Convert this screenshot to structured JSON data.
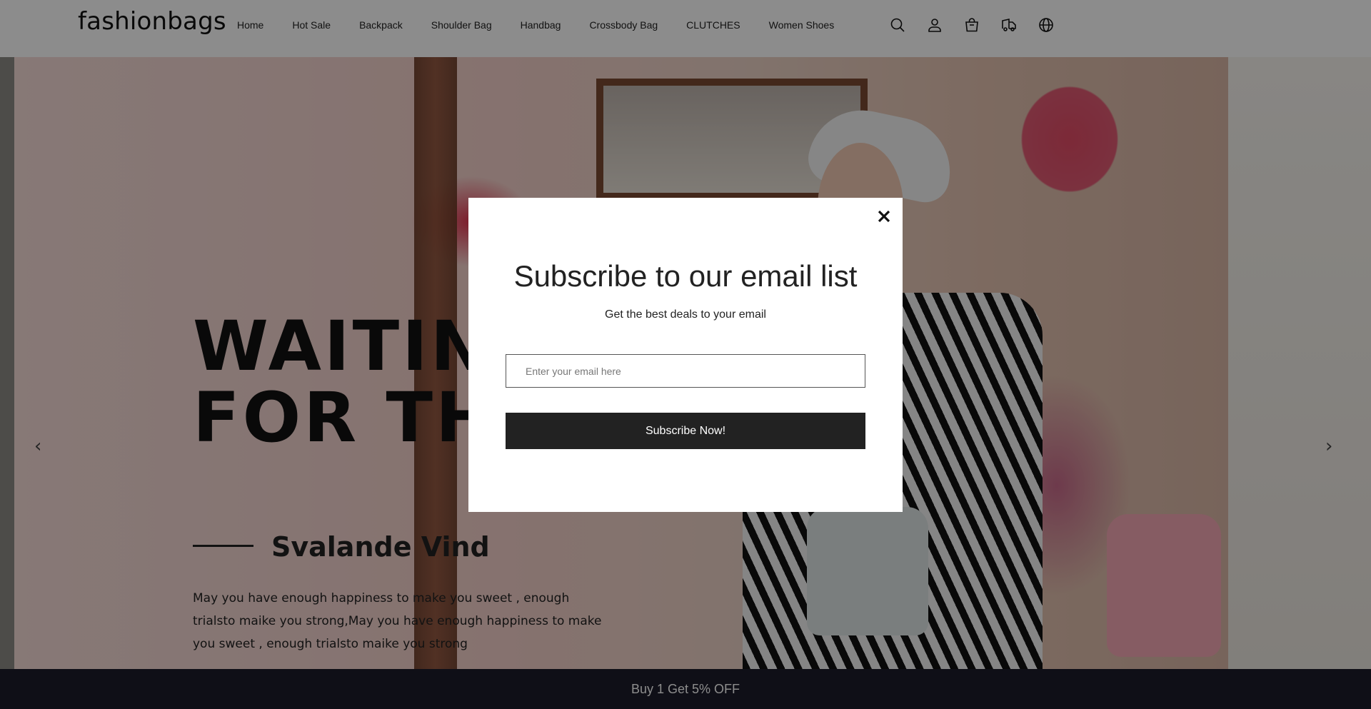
{
  "brand": {
    "logo_text": "fashionbags"
  },
  "nav": {
    "items": [
      {
        "label": "Home"
      },
      {
        "label": "Hot Sale"
      },
      {
        "label": "Backpack"
      },
      {
        "label": "Shoulder Bag"
      },
      {
        "label": "Handbag"
      },
      {
        "label": "Crossbody Bag"
      },
      {
        "label": "CLUTCHES"
      },
      {
        "label": "Women Shoes"
      }
    ]
  },
  "header_icons": [
    "search-icon",
    "account-icon",
    "cart-icon",
    "shipping-icon",
    "language-icon"
  ],
  "hero": {
    "title_line1": "WAITING",
    "title_line2": "FOR THE",
    "subtitle": "Svalande Vind",
    "body": "May you have enough happiness to make you sweet , enough trialsto maike you strong,May you have enough happiness to make you sweet , enough trialsto maike you strong",
    "prev_arrow": "‹",
    "next_arrow": "›"
  },
  "announcement": {
    "text": "Buy 1 Get 5% OFF"
  },
  "modal": {
    "title": "Subscribe to our email list",
    "subtitle": "Get the best deals to your email",
    "email_placeholder": "Enter your email here",
    "email_value": "",
    "button_label": "Subscribe Now!"
  },
  "colors": {
    "overlay": "rgba(0,0,0,0.45)",
    "button_bg": "#222222",
    "announcement_bg": "#1d1d2b"
  }
}
